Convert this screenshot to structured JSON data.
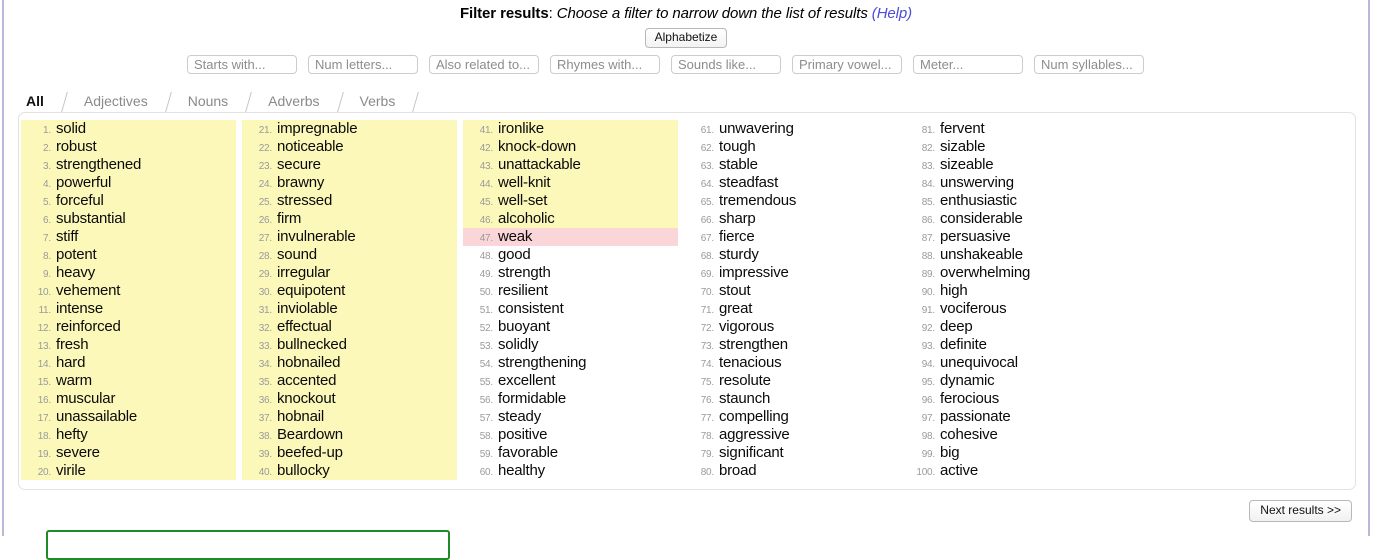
{
  "header": {
    "label": "Filter results",
    "separator": ":",
    "description": "Choose a filter to narrow down the list of results",
    "help_open": "(",
    "help": "Help",
    "help_close": ")"
  },
  "toolbar": {
    "alphabetize_label": "Alphabetize"
  },
  "filters": [
    {
      "name": "starts-with",
      "placeholder": "Starts with...",
      "value": ""
    },
    {
      "name": "num-letters",
      "placeholder": "Num letters...",
      "value": ""
    },
    {
      "name": "also-related-to",
      "placeholder": "Also related to...",
      "value": ""
    },
    {
      "name": "rhymes-with",
      "placeholder": "Rhymes with...",
      "value": ""
    },
    {
      "name": "sounds-like",
      "placeholder": "Sounds like...",
      "value": ""
    },
    {
      "name": "primary-vowel",
      "placeholder": "Primary vowel...",
      "value": ""
    },
    {
      "name": "meter",
      "placeholder": "Meter...",
      "value": ""
    },
    {
      "name": "num-syllables",
      "placeholder": "Num syllables...",
      "value": ""
    }
  ],
  "tabs": [
    {
      "label": "All",
      "active": true
    },
    {
      "label": "Adjectives",
      "active": false
    },
    {
      "label": "Nouns",
      "active": false
    },
    {
      "label": "Adverbs",
      "active": false
    },
    {
      "label": "Verbs",
      "active": false
    }
  ],
  "colors": {
    "synonym_highlight": "#fbf8ba",
    "antonym_highlight": "#fbd6d8",
    "help_link": "#4b4bdd",
    "page_border": "#bcb6d8",
    "green_box_border": "#1e8a28"
  },
  "results": {
    "columns": [
      {
        "items": [
          {
            "num": "1.",
            "word": "solid",
            "highlight": "synonym"
          },
          {
            "num": "2.",
            "word": "robust",
            "highlight": "synonym"
          },
          {
            "num": "3.",
            "word": "strengthened",
            "highlight": "synonym"
          },
          {
            "num": "4.",
            "word": "powerful",
            "highlight": "synonym"
          },
          {
            "num": "5.",
            "word": "forceful",
            "highlight": "synonym"
          },
          {
            "num": "6.",
            "word": "substantial",
            "highlight": "synonym"
          },
          {
            "num": "7.",
            "word": "stiff",
            "highlight": "synonym"
          },
          {
            "num": "8.",
            "word": "potent",
            "highlight": "synonym"
          },
          {
            "num": "9.",
            "word": "heavy",
            "highlight": "synonym"
          },
          {
            "num": "10.",
            "word": "vehement",
            "highlight": "synonym"
          },
          {
            "num": "11.",
            "word": "intense",
            "highlight": "synonym"
          },
          {
            "num": "12.",
            "word": "reinforced",
            "highlight": "synonym"
          },
          {
            "num": "13.",
            "word": "fresh",
            "highlight": "synonym"
          },
          {
            "num": "14.",
            "word": "hard",
            "highlight": "synonym"
          },
          {
            "num": "15.",
            "word": "warm",
            "highlight": "synonym"
          },
          {
            "num": "16.",
            "word": "muscular",
            "highlight": "synonym"
          },
          {
            "num": "17.",
            "word": "unassailable",
            "highlight": "synonym"
          },
          {
            "num": "18.",
            "word": "hefty",
            "highlight": "synonym"
          },
          {
            "num": "19.",
            "word": "severe",
            "highlight": "synonym"
          },
          {
            "num": "20.",
            "word": "virile",
            "highlight": "synonym"
          }
        ]
      },
      {
        "items": [
          {
            "num": "21.",
            "word": "impregnable",
            "highlight": "synonym"
          },
          {
            "num": "22.",
            "word": "noticeable",
            "highlight": "synonym"
          },
          {
            "num": "23.",
            "word": "secure",
            "highlight": "synonym"
          },
          {
            "num": "24.",
            "word": "brawny",
            "highlight": "synonym"
          },
          {
            "num": "25.",
            "word": "stressed",
            "highlight": "synonym"
          },
          {
            "num": "26.",
            "word": "firm",
            "highlight": "synonym"
          },
          {
            "num": "27.",
            "word": "invulnerable",
            "highlight": "synonym"
          },
          {
            "num": "28.",
            "word": "sound",
            "highlight": "synonym"
          },
          {
            "num": "29.",
            "word": "irregular",
            "highlight": "synonym"
          },
          {
            "num": "30.",
            "word": "equipotent",
            "highlight": "synonym"
          },
          {
            "num": "31.",
            "word": "inviolable",
            "highlight": "synonym"
          },
          {
            "num": "32.",
            "word": "effectual",
            "highlight": "synonym"
          },
          {
            "num": "33.",
            "word": "bullnecked",
            "highlight": "synonym"
          },
          {
            "num": "34.",
            "word": "hobnailed",
            "highlight": "synonym"
          },
          {
            "num": "35.",
            "word": "accented",
            "highlight": "synonym"
          },
          {
            "num": "36.",
            "word": "knockout",
            "highlight": "synonym"
          },
          {
            "num": "37.",
            "word": "hobnail",
            "highlight": "synonym"
          },
          {
            "num": "38.",
            "word": "Beardown",
            "highlight": "synonym"
          },
          {
            "num": "39.",
            "word": "beefed-up",
            "highlight": "synonym"
          },
          {
            "num": "40.",
            "word": "bullocky",
            "highlight": "synonym"
          }
        ]
      },
      {
        "items": [
          {
            "num": "41.",
            "word": "ironlike",
            "highlight": "synonym"
          },
          {
            "num": "42.",
            "word": "knock-down",
            "highlight": "synonym"
          },
          {
            "num": "43.",
            "word": "unattackable",
            "highlight": "synonym"
          },
          {
            "num": "44.",
            "word": "well-knit",
            "highlight": "synonym"
          },
          {
            "num": "45.",
            "word": "well-set",
            "highlight": "synonym"
          },
          {
            "num": "46.",
            "word": "alcoholic",
            "highlight": "synonym"
          },
          {
            "num": "47.",
            "word": "weak",
            "highlight": "antonym"
          },
          {
            "num": "48.",
            "word": "good",
            "highlight": "none"
          },
          {
            "num": "49.",
            "word": "strength",
            "highlight": "none"
          },
          {
            "num": "50.",
            "word": "resilient",
            "highlight": "none"
          },
          {
            "num": "51.",
            "word": "consistent",
            "highlight": "none"
          },
          {
            "num": "52.",
            "word": "buoyant",
            "highlight": "none"
          },
          {
            "num": "53.",
            "word": "solidly",
            "highlight": "none"
          },
          {
            "num": "54.",
            "word": "strengthening",
            "highlight": "none"
          },
          {
            "num": "55.",
            "word": "excellent",
            "highlight": "none"
          },
          {
            "num": "56.",
            "word": "formidable",
            "highlight": "none"
          },
          {
            "num": "57.",
            "word": "steady",
            "highlight": "none"
          },
          {
            "num": "58.",
            "word": "positive",
            "highlight": "none"
          },
          {
            "num": "59.",
            "word": "favorable",
            "highlight": "none"
          },
          {
            "num": "60.",
            "word": "healthy",
            "highlight": "none"
          }
        ]
      },
      {
        "items": [
          {
            "num": "61.",
            "word": "unwavering",
            "highlight": "none"
          },
          {
            "num": "62.",
            "word": "tough",
            "highlight": "none"
          },
          {
            "num": "63.",
            "word": "stable",
            "highlight": "none"
          },
          {
            "num": "64.",
            "word": "steadfast",
            "highlight": "none"
          },
          {
            "num": "65.",
            "word": "tremendous",
            "highlight": "none"
          },
          {
            "num": "66.",
            "word": "sharp",
            "highlight": "none"
          },
          {
            "num": "67.",
            "word": "fierce",
            "highlight": "none"
          },
          {
            "num": "68.",
            "word": "sturdy",
            "highlight": "none"
          },
          {
            "num": "69.",
            "word": "impressive",
            "highlight": "none"
          },
          {
            "num": "70.",
            "word": "stout",
            "highlight": "none"
          },
          {
            "num": "71.",
            "word": "great",
            "highlight": "none"
          },
          {
            "num": "72.",
            "word": "vigorous",
            "highlight": "none"
          },
          {
            "num": "73.",
            "word": "strengthen",
            "highlight": "none"
          },
          {
            "num": "74.",
            "word": "tenacious",
            "highlight": "none"
          },
          {
            "num": "75.",
            "word": "resolute",
            "highlight": "none"
          },
          {
            "num": "76.",
            "word": "staunch",
            "highlight": "none"
          },
          {
            "num": "77.",
            "word": "compelling",
            "highlight": "none"
          },
          {
            "num": "78.",
            "word": "aggressive",
            "highlight": "none"
          },
          {
            "num": "79.",
            "word": "significant",
            "highlight": "none"
          },
          {
            "num": "80.",
            "word": "broad",
            "highlight": "none"
          }
        ]
      },
      {
        "items": [
          {
            "num": "81.",
            "word": "fervent",
            "highlight": "none"
          },
          {
            "num": "82.",
            "word": "sizable",
            "highlight": "none"
          },
          {
            "num": "83.",
            "word": "sizeable",
            "highlight": "none"
          },
          {
            "num": "84.",
            "word": "unswerving",
            "highlight": "none"
          },
          {
            "num": "85.",
            "word": "enthusiastic",
            "highlight": "none"
          },
          {
            "num": "86.",
            "word": "considerable",
            "highlight": "none"
          },
          {
            "num": "87.",
            "word": "persuasive",
            "highlight": "none"
          },
          {
            "num": "88.",
            "word": "unshakeable",
            "highlight": "none"
          },
          {
            "num": "89.",
            "word": "overwhelming",
            "highlight": "none"
          },
          {
            "num": "90.",
            "word": "high",
            "highlight": "none"
          },
          {
            "num": "91.",
            "word": "vociferous",
            "highlight": "none"
          },
          {
            "num": "92.",
            "word": "deep",
            "highlight": "none"
          },
          {
            "num": "93.",
            "word": "definite",
            "highlight": "none"
          },
          {
            "num": "94.",
            "word": "unequivocal",
            "highlight": "none"
          },
          {
            "num": "95.",
            "word": "dynamic",
            "highlight": "none"
          },
          {
            "num": "96.",
            "word": "ferocious",
            "highlight": "none"
          },
          {
            "num": "97.",
            "word": "passionate",
            "highlight": "none"
          },
          {
            "num": "98.",
            "word": "cohesive",
            "highlight": "none"
          },
          {
            "num": "99.",
            "word": "big",
            "highlight": "none"
          },
          {
            "num": "100.",
            "word": "active",
            "highlight": "none"
          }
        ]
      }
    ]
  },
  "footer": {
    "next_results_label": "Next results >>"
  }
}
